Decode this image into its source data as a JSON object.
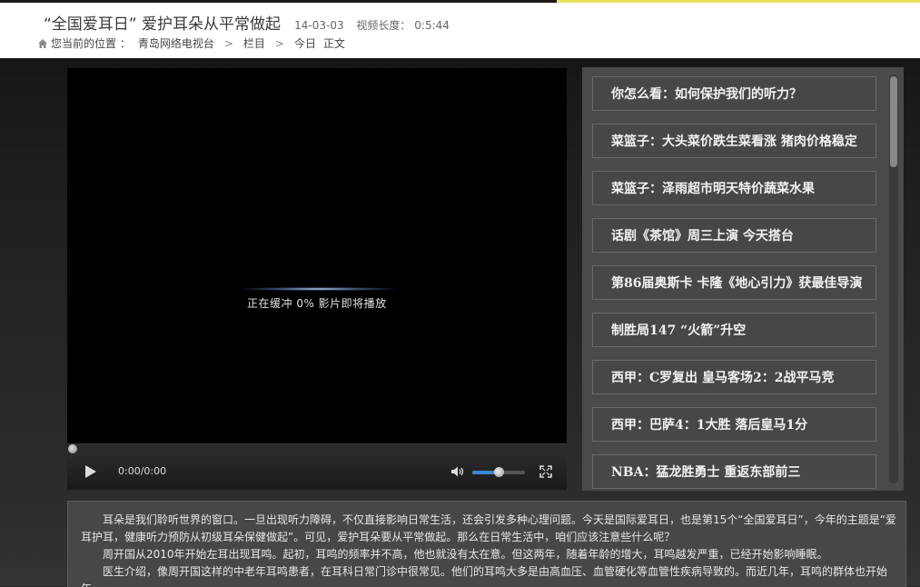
{
  "header": {
    "title": "“全国爱耳日” 爱护耳朵从平常做起",
    "date": "14-03-03",
    "duration_label": "视频长度：",
    "duration": "0:5:44",
    "breadcrumb": {
      "prefix": "您当前的位置 ：",
      "items": [
        "青岛网络电视台",
        "栏目",
        "今日",
        "正文"
      ]
    }
  },
  "player": {
    "loading_text": "正在缓冲 0% 影片即将播放",
    "time": "0:00/0:00",
    "progress": 0,
    "volume": 0.5,
    "icons": [
      "play-icon",
      "volume-icon",
      "fullscreen-icon"
    ]
  },
  "playlist": {
    "items": [
      "你怎么看：如何保护我们的听力？",
      "菜篮子：大头菜价跌生菜看涨 猪肉价格稳定",
      "菜篮子：泽雨超市明天特价蔬菜水果",
      "话剧《茶馆》周三上演 今天搭台",
      "第86届奥斯卡 卡隆《地心引力》获最佳导演",
      "制胜局147 “火箭”升空",
      "西甲：C罗复出 皇马客场2：2战平马竞",
      "西甲：巴萨4：1大胜 落后皇马1分",
      "NBA：猛龙胜勇士  重返东部前三"
    ]
  },
  "article": {
    "paragraphs": [
      "耳朵是我们聆听世界的窗口。一旦出现听力障碍，不仅直接影响日常生活，还会引发多种心理问题。今天是国际爱耳日，也是第15个“全国爱耳日”，今年的主题是“爱耳护耳，健康听力预防从初级耳朵保健做起”。可见，爱护耳朵要从平常做起。那么在日常生活中，咱们应该注意些什么呢？",
      "周开国从2010年开始左耳出现耳鸣。起初，耳鸣的频率并不高，他也就没有太在意。但这两年，随着年龄的增大，耳鸣越发严重，已经开始影响睡眠。",
      "医生介绍，像周开国这样的中老年耳鸣患者，在耳科日常门诊中很常见。他们的耳鸣大多是由高血压、血管硬化等血管性疾病导致的。而近几年，耳鸣的群体也开始年"
    ]
  },
  "colors": {
    "accent_strip": "#e8e060",
    "volume_fill": "#3a86d0",
    "playlist_bg": "#4a4a4a"
  }
}
